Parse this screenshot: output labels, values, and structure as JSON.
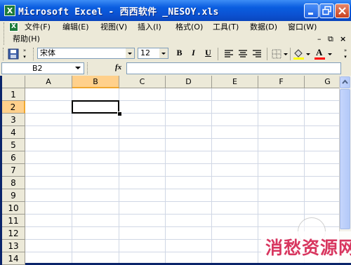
{
  "window": {
    "title": "Microsoft Excel - 西西软件 _NESOY.xls",
    "app_icon": "excel-icon",
    "icon_letter": "X"
  },
  "menu": {
    "items": [
      {
        "label": "文件(F)"
      },
      {
        "label": "编辑(E)"
      },
      {
        "label": "视图(V)"
      },
      {
        "label": "插入(I)"
      },
      {
        "label": "格式(O)"
      },
      {
        "label": "工具(T)"
      },
      {
        "label": "数据(D)"
      },
      {
        "label": "窗口(W)"
      },
      {
        "label": "帮助(H)"
      }
    ]
  },
  "toolbar": {
    "font_name": "宋体",
    "font_size": "12",
    "bold": "B",
    "italic": "I",
    "underline": "U",
    "font_color_letter": "A",
    "fill_color": "#ffff00",
    "font_color": "#ff0000"
  },
  "formula_bar": {
    "name_box": "B2",
    "fx_label": "fx",
    "content": ""
  },
  "sheet": {
    "columns": [
      "A",
      "B",
      "C",
      "D",
      "E",
      "F",
      "G"
    ],
    "rows": [
      "1",
      "2",
      "3",
      "4",
      "5",
      "6",
      "7",
      "8",
      "9",
      "10",
      "11",
      "12",
      "13",
      "14"
    ],
    "selected_cell": "B2",
    "selection_color": "#ffd08b"
  },
  "watermark": {
    "text": "消愁资源网"
  }
}
